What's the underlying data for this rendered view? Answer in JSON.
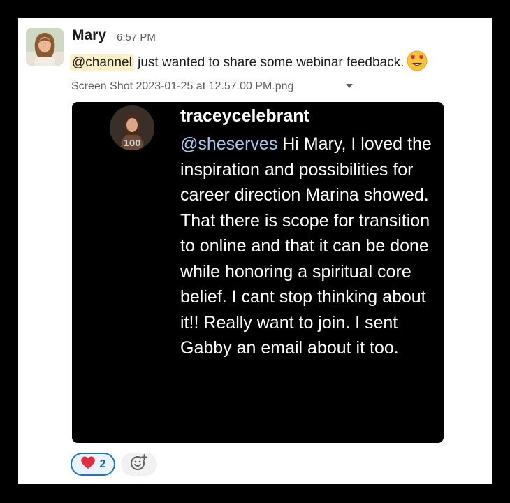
{
  "message": {
    "author": "Mary",
    "time": "6:57 PM",
    "mention": "@channel",
    "text": " just wanted to share some webinar feedback.",
    "emoji": "heart-eyes-emoji"
  },
  "attachment": {
    "filename": "Screen Shot 2023-01-25 at 12.57.00 PM.png",
    "comment_user": "traceycelebrant",
    "comment_mention": "@sheserves",
    "comment_text": " Hi Mary, I loved the inspiration and possibilities for career direction Marina showed. That there is scope for transition to online and that it can be done while honoring a spiritual core belief. I cant stop thinking about it!! Really want to join. I sent Gabby an email about it too."
  },
  "reactions": [
    {
      "emoji": "heart-emoji",
      "count": "2"
    }
  ],
  "colors": {
    "mention_highlight": "#fdf0c5",
    "reaction_border": "#1d74c9",
    "link_blue": "#1264a3"
  }
}
